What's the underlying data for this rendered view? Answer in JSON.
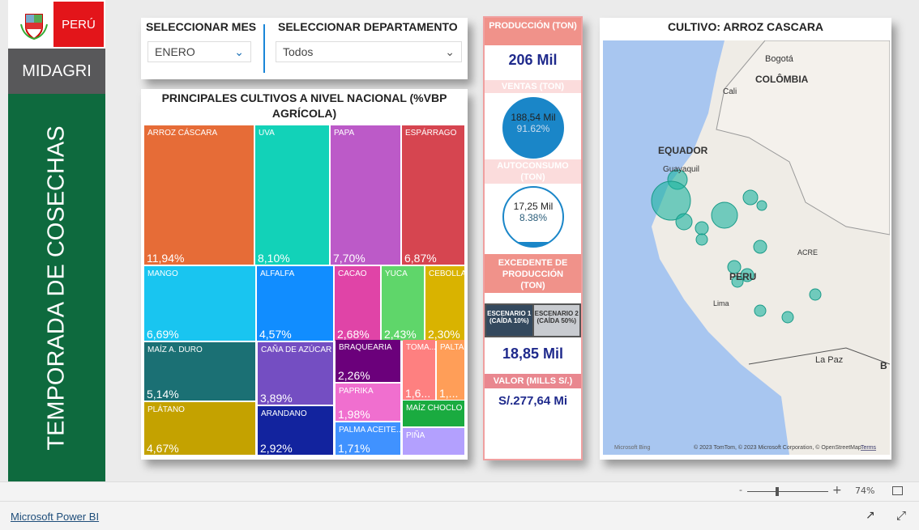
{
  "brand": {
    "peru": "PERÚ",
    "midagri": "MIDAGRI",
    "side_title": "TEMPORADA DE COSECHAS"
  },
  "slicers": {
    "month_label": "SELECCIONAR MES",
    "month_value": "ENERO",
    "dept_label": "SELECCIONAR DEPARTAMENTO",
    "dept_value": "Todos"
  },
  "treemap": {
    "title": "PRINCIPALES CULTIVOS A NIVEL NACIONAL (%VBP AGRÍCOLA)",
    "tiles": [
      {
        "name": "ARROZ CÁSCARA",
        "value": "11,94%",
        "color": "#e66c37"
      },
      {
        "name": "UVA",
        "value": "8,10%",
        "color": "#12d2b8"
      },
      {
        "name": "PAPA",
        "value": "7,70%",
        "color": "#bc5ac8"
      },
      {
        "name": "ESPÁRRAGO",
        "value": "6,87%",
        "color": "#d64550"
      },
      {
        "name": "MANGO",
        "value": "6,69%",
        "color": "#19c5f0"
      },
      {
        "name": "ALFALFA",
        "value": "4,57%",
        "color": "#118dff"
      },
      {
        "name": "CACAO",
        "value": "2,68%",
        "color": "#e044a7"
      },
      {
        "name": "YUCA",
        "value": "2,43%",
        "color": "#5fd66a"
      },
      {
        "name": "CEBOLLA",
        "value": "2,30%",
        "color": "#d9b300"
      },
      {
        "name": "MAÍZ A. DURO",
        "value": "5,14%",
        "color": "#1b7074"
      },
      {
        "name": "CAÑA DE AZÚCAR",
        "value": "3,89%",
        "color": "#744ec2"
      },
      {
        "name": "BRAQUEARIA",
        "value": "2,26%",
        "color": "#6b007b"
      },
      {
        "name": "TOMA...",
        "value": "1,6...",
        "color": "#fe8080"
      },
      {
        "name": "PALTA",
        "value": "1,...",
        "color": "#ff9e58"
      },
      {
        "name": "PAPRIKA",
        "value": "1,98%",
        "color": "#f06fcf"
      },
      {
        "name": "PLÁTANO",
        "value": "4,67%",
        "color": "#c4a200"
      },
      {
        "name": "ARANDANO",
        "value": "2,92%",
        "color": "#12239e"
      },
      {
        "name": "MAÍZ CHOCLO",
        "value": "",
        "color": "#1aab40"
      },
      {
        "name": "PALMA ACEITE...",
        "value": "1,71%",
        "color": "#4092ff"
      },
      {
        "name": "PIÑA",
        "value": "",
        "color": "#b3a0fe"
      }
    ]
  },
  "kpis": {
    "produccion_label": "PRODUCCIÓN (TON)",
    "produccion_value": "206 Mil",
    "ventas_label": "VENTAS (TON)",
    "ventas_value": "188,54 Mil",
    "ventas_pct": "91.62%",
    "auto_label": "AUTOCONSUMO (TON)",
    "auto_value": "17,25 Mil",
    "auto_pct": "8.38%",
    "excedente_label": "EXCEDENTE DE PRODUCCIÓN (TON)",
    "escenario1": "ESCENARIO 1 (CAÍDA 10%)",
    "escenario2": "ESCENARIO 2 (CAÍDA 50%)",
    "excedente_value": "18,85 Mil",
    "valor_label": "VALOR (MILLS S/.)",
    "valor_value": "S/.277,64 Mi",
    "ventas_fill": 0.9162,
    "auto_fill": 0.0838
  },
  "map": {
    "title": "CULTIVO: ARROZ CASCARA",
    "labels": [
      "Bogotá",
      "COLÔMBIA",
      "Cali",
      "EQUADOR",
      "Guayaquil",
      "PERU",
      "ACRE",
      "Lima",
      "La Paz",
      "B"
    ],
    "bing": "Microsoft Bing",
    "copyright": "© 2023 TomTom, © 2023 Microsoft Corporation, © OpenStreetMap",
    "terms": "Terms"
  },
  "zoom": {
    "minus": "-",
    "plus": "+",
    "level": "74%",
    "slider_percent": 37
  },
  "footer": {
    "link": "Microsoft Power BI"
  }
}
